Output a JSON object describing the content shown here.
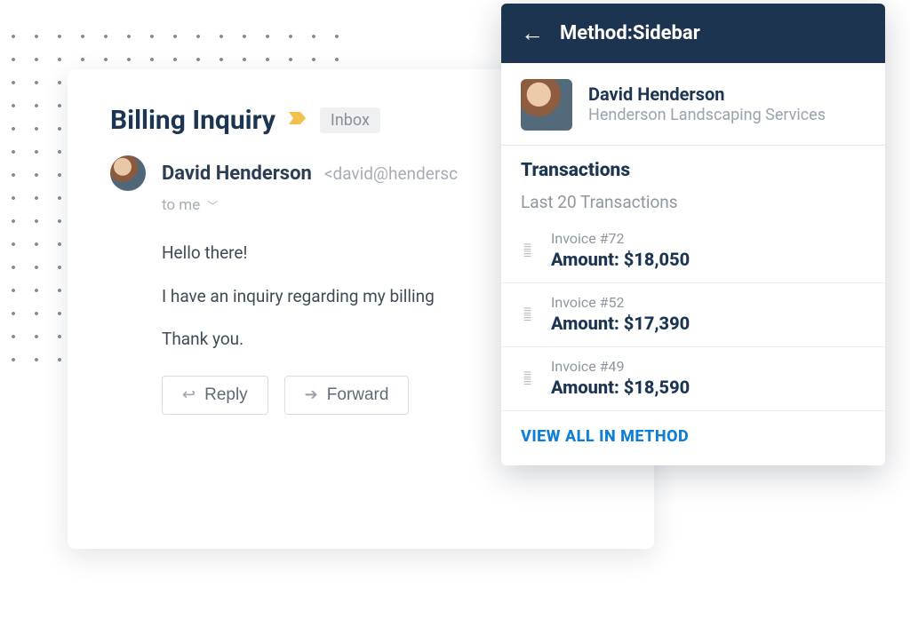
{
  "email": {
    "subject": "Billing Inquiry",
    "folder": "Inbox",
    "sender_name": "David Henderson",
    "sender_email": "<david@hendersc",
    "recipient_line": "to me",
    "body_p1": "Hello there!",
    "body_p2": "I have an inquiry regarding my billing",
    "body_p3": "Thank you.",
    "reply_label": "Reply",
    "forward_label": "Forward"
  },
  "sidebar": {
    "title": "Method:Sidebar",
    "contact_name": "David Henderson",
    "contact_company": "Henderson Landscaping Services",
    "section_title": "Transactions",
    "section_subtitle": "Last 20 Transactions",
    "transactions": [
      {
        "label": "Invoice #72",
        "amount": "Amount: $18,050"
      },
      {
        "label": "Invoice #52",
        "amount": "Amount: $17,390"
      },
      {
        "label": "Invoice #49",
        "amount": "Amount: $18,590"
      }
    ],
    "view_all": "VIEW ALL IN METHOD"
  }
}
